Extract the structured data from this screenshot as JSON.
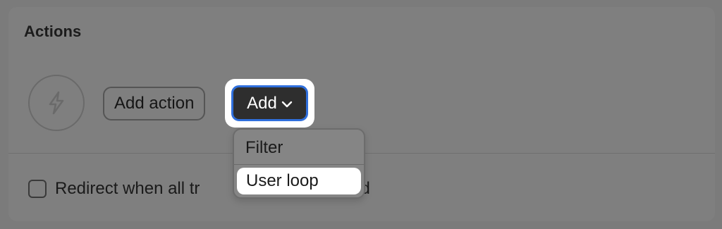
{
  "section": {
    "title": "Actions"
  },
  "trigger": {
    "icon": "lightning-bolt-icon"
  },
  "buttons": {
    "add_action_label": "Add action",
    "add_label": "Add"
  },
  "dropdown": {
    "items": [
      {
        "label": "Filter"
      },
      {
        "label": "User loop"
      }
    ]
  },
  "options": {
    "redirect_label": "Redirect when all tr",
    "redirect_label_tail": "pleted",
    "redirect_checked": false
  },
  "colors": {
    "focus_border": "#2f6fdc",
    "add_button_bg": "#2e2e2e",
    "overlay_bg": "#7b7b7b"
  }
}
